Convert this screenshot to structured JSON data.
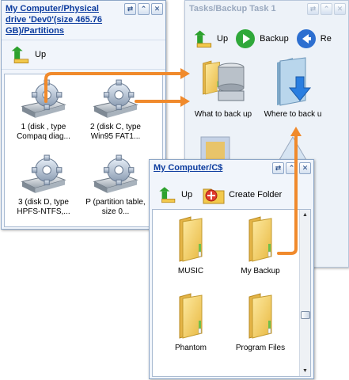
{
  "window1": {
    "title": "My Computer/Physical drive 'Dev0'(size 465.76 GB)/Partitions",
    "toolbar": {
      "up_label": "Up"
    },
    "items": [
      {
        "label": "1 (disk , type Compaq diag..."
      },
      {
        "label": "2 (disk C, type Win95 FAT1..."
      },
      {
        "label": "3 (disk D, type HPFS-NTFS,..."
      },
      {
        "label": "P (partition table, size 0..."
      }
    ]
  },
  "window2": {
    "title": "Tasks/Backup Task 1",
    "toolbar": {
      "up_label": "Up",
      "backup_label": "Backup",
      "restore_label": "Re"
    },
    "items": [
      {
        "label": "What to back up"
      },
      {
        "label": "Where to back u"
      }
    ]
  },
  "window3": {
    "title": "My Computer/C$",
    "toolbar": {
      "up_label": "Up",
      "create_folder_label": "Create Folder"
    },
    "items": [
      {
        "label": "MUSIC"
      },
      {
        "label": "My Backup"
      },
      {
        "label": "Phantom"
      },
      {
        "label": "Program Files"
      }
    ]
  },
  "colors": {
    "arrow": "#f08a2c",
    "title_link": "#0b3b9e",
    "border": "#8da6c6"
  },
  "icons": [
    "drive-gear-icon",
    "folder-icon",
    "database-icon",
    "up-arrow-icon",
    "play-icon",
    "restore-icon",
    "create-folder-icon",
    "refresh-icon",
    "maximize-icon",
    "close-icon"
  ]
}
